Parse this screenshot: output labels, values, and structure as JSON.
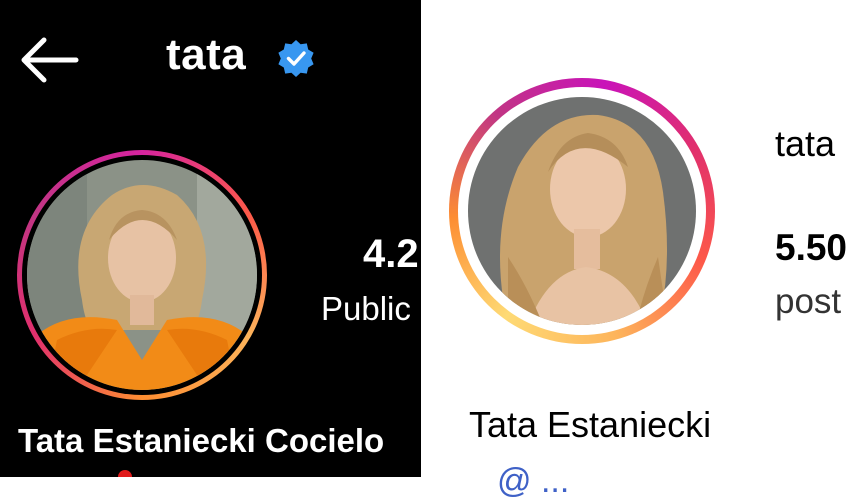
{
  "left_panel": {
    "header": {
      "username": "tata",
      "back_icon": "arrow-left-icon",
      "verified_icon": "verified-badge-icon",
      "verified_color": "#3897f0"
    },
    "stat": {
      "value": "4.2",
      "label": "Public"
    },
    "display_name": "Tata Estaniecki Cocielo",
    "ring_colors": [
      "#d6249f",
      "#fd5949",
      "#fdb45b"
    ]
  },
  "right_panel": {
    "username": "tata",
    "stat": {
      "value": "5.50",
      "label": "post"
    },
    "display_name": "Tata Estaniecki",
    "bio_link": "@ ...",
    "link_color": "#3f61c7",
    "ring_colors": [
      "#c913b9",
      "#fd5949",
      "#feda75"
    ]
  }
}
